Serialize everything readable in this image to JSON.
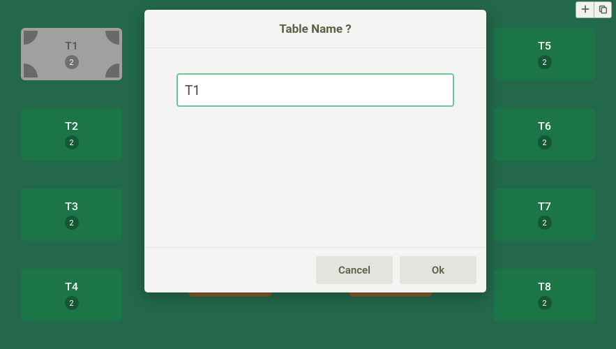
{
  "toolbar": {
    "add_icon": "plus",
    "copy_icon": "duplicate"
  },
  "tables": {
    "left": [
      {
        "label": "T1",
        "count": "2",
        "selected": true
      },
      {
        "label": "T2",
        "count": "2",
        "selected": false
      },
      {
        "label": "T3",
        "count": "2",
        "selected": false
      },
      {
        "label": "T4",
        "count": "2",
        "selected": false
      }
    ],
    "right": [
      {
        "label": "T5",
        "count": "2",
        "selected": false
      },
      {
        "label": "T6",
        "count": "2",
        "selected": false
      },
      {
        "label": "T7",
        "count": "2",
        "selected": false
      },
      {
        "label": "T8",
        "count": "2",
        "selected": false
      }
    ]
  },
  "modal": {
    "title": "Table Name ?",
    "input_value": "T1",
    "cancel_label": "Cancel",
    "ok_label": "Ok"
  }
}
